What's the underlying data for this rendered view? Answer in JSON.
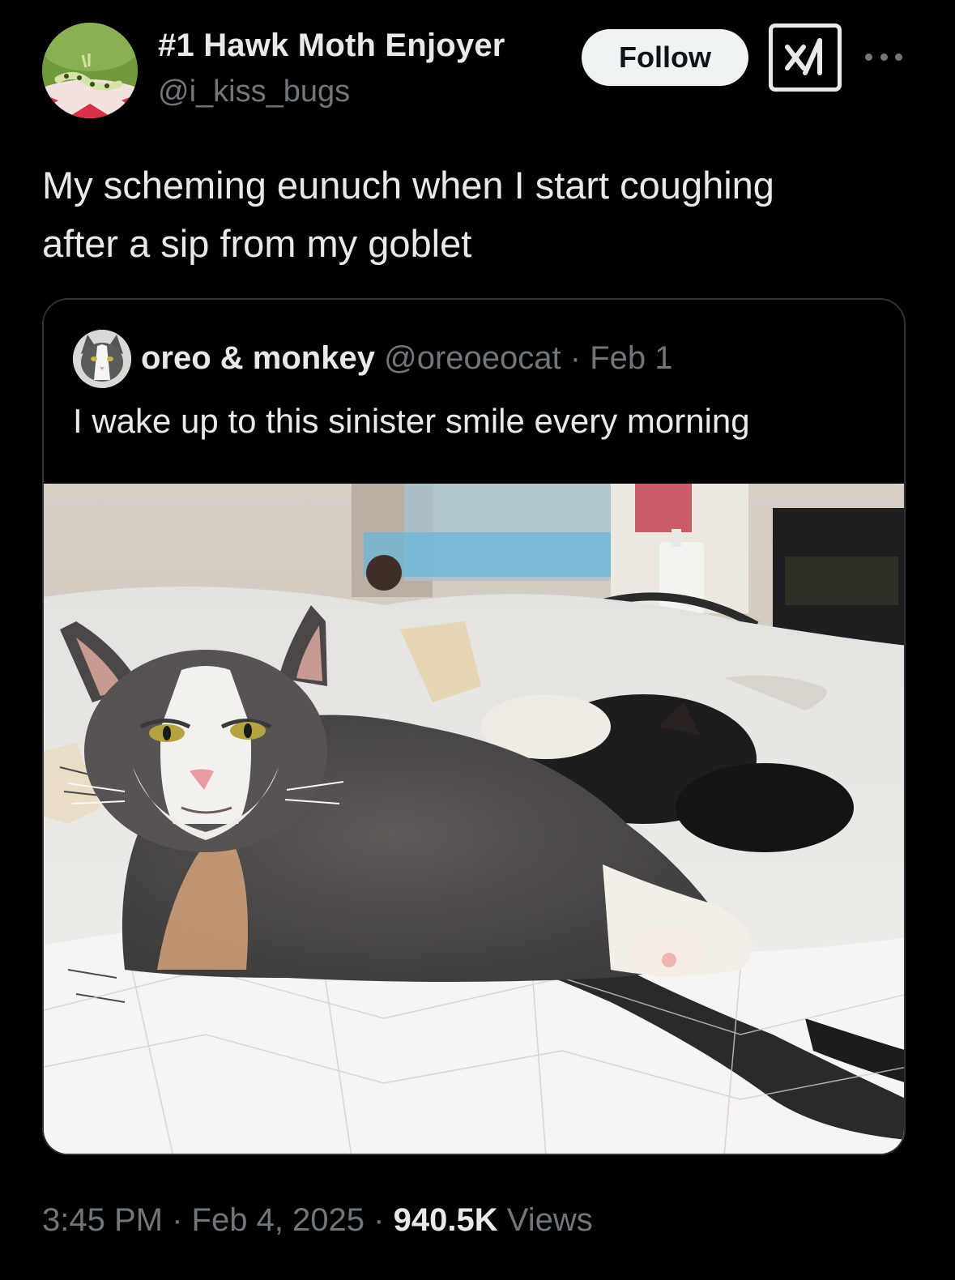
{
  "author": {
    "display_name": "#1 Hawk Moth Enjoyer",
    "handle": "@i_kiss_bugs",
    "avatar_icon": "caterpillar-avatar"
  },
  "actions": {
    "follow_label": "Follow",
    "grok_icon": "grok-icon",
    "more_icon": "more-icon"
  },
  "tweet": {
    "line1": "My scheming eunuch when I start coughing",
    "line2": "after a sip from my goblet"
  },
  "quoted_tweet": {
    "display_name": "oreo & monkey",
    "handle": "@oreoeocat",
    "separator": "·",
    "date": "Feb 1",
    "text": "I wake up to this sinister smile every morning",
    "avatar_icon": "cat-avatar",
    "media_icon": "cat-photo"
  },
  "meta": {
    "time": "3:45 PM",
    "sep1": "·",
    "date": "Feb 4, 2025",
    "sep2": "·",
    "views_count": "940.5K",
    "views_label": "Views"
  },
  "colors": {
    "background": "#000000",
    "primary_text": "#e7e9ea",
    "secondary_text": "#71767b",
    "border": "#2f3336",
    "follow_bg": "#eff3f4"
  }
}
